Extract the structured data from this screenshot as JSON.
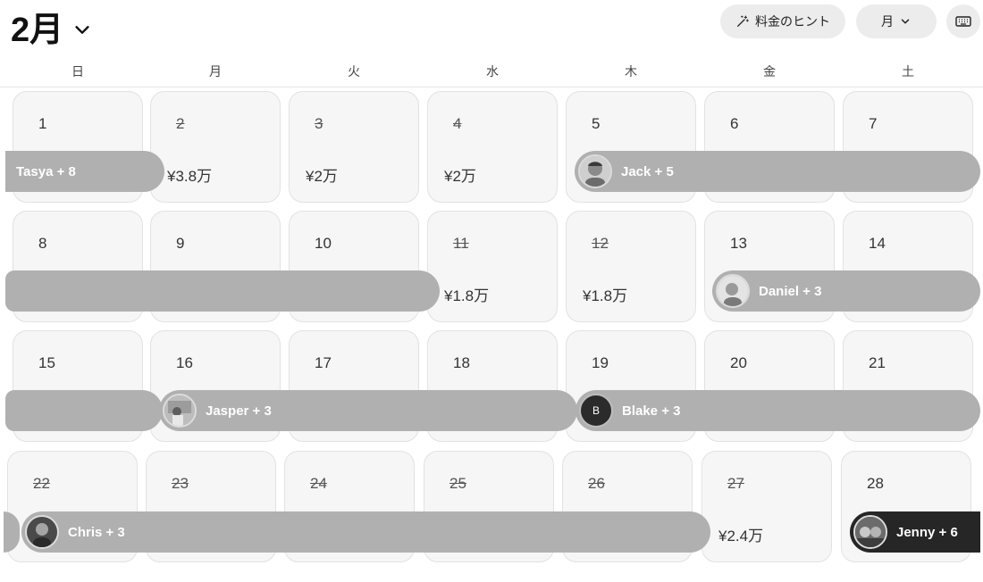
{
  "header": {
    "month_title": "2月",
    "hint_label": "料金のヒント",
    "view_label": "月"
  },
  "weekdays": [
    "日",
    "月",
    "火",
    "水",
    "木",
    "金",
    "土"
  ],
  "days": [
    {
      "day": "1",
      "price": "",
      "strike": false
    },
    {
      "day": "2",
      "price": "¥3.8万",
      "strike": true
    },
    {
      "day": "3",
      "price": "¥2万",
      "strike": true
    },
    {
      "day": "4",
      "price": "¥2万",
      "strike": true
    },
    {
      "day": "5",
      "price": "",
      "strike": false
    },
    {
      "day": "6",
      "price": "",
      "strike": false
    },
    {
      "day": "7",
      "price": "",
      "strike": false
    },
    {
      "day": "8",
      "price": "",
      "strike": false
    },
    {
      "day": "9",
      "price": "",
      "strike": false
    },
    {
      "day": "10",
      "price": "",
      "strike": false
    },
    {
      "day": "11",
      "price": "¥1.8万",
      "strike": true
    },
    {
      "day": "12",
      "price": "¥1.8万",
      "strike": true
    },
    {
      "day": "13",
      "price": "",
      "strike": false
    },
    {
      "day": "14",
      "price": "",
      "strike": false
    },
    {
      "day": "15",
      "price": "",
      "strike": false
    },
    {
      "day": "16",
      "price": "",
      "strike": false
    },
    {
      "day": "17",
      "price": "",
      "strike": false
    },
    {
      "day": "18",
      "price": "",
      "strike": false
    },
    {
      "day": "19",
      "price": "",
      "strike": false
    },
    {
      "day": "20",
      "price": "",
      "strike": false
    },
    {
      "day": "21",
      "price": "",
      "strike": false
    },
    {
      "day": "22",
      "price": "",
      "strike": true
    },
    {
      "day": "23",
      "price": "",
      "strike": true
    },
    {
      "day": "24",
      "price": "",
      "strike": true
    },
    {
      "day": "25",
      "price": "",
      "strike": true
    },
    {
      "day": "26",
      "price": "",
      "strike": true
    },
    {
      "day": "27",
      "price": "¥2.4万",
      "strike": true
    },
    {
      "day": "28",
      "price": "",
      "strike": false
    }
  ],
  "reservations": [
    {
      "label": "Tasya + 8",
      "avatar": "none",
      "style": "gray"
    },
    {
      "label": "Jack + 5",
      "avatar": "photo",
      "style": "gray"
    },
    {
      "label": "",
      "avatar": "none",
      "style": "gray"
    },
    {
      "label": "Daniel + 3",
      "avatar": "photo",
      "style": "gray"
    },
    {
      "label": "",
      "avatar": "none",
      "style": "gray"
    },
    {
      "label": "Jasper + 3",
      "avatar": "photo",
      "style": "gray"
    },
    {
      "label": "Blake + 3",
      "avatar": "letter",
      "initial": "B",
      "style": "gray"
    },
    {
      "label": "",
      "avatar": "none",
      "style": "gray"
    },
    {
      "label": "Chris + 3",
      "avatar": "photo",
      "style": "gray"
    },
    {
      "label": "Jenny + 6",
      "avatar": "photo",
      "style": "dark"
    }
  ]
}
